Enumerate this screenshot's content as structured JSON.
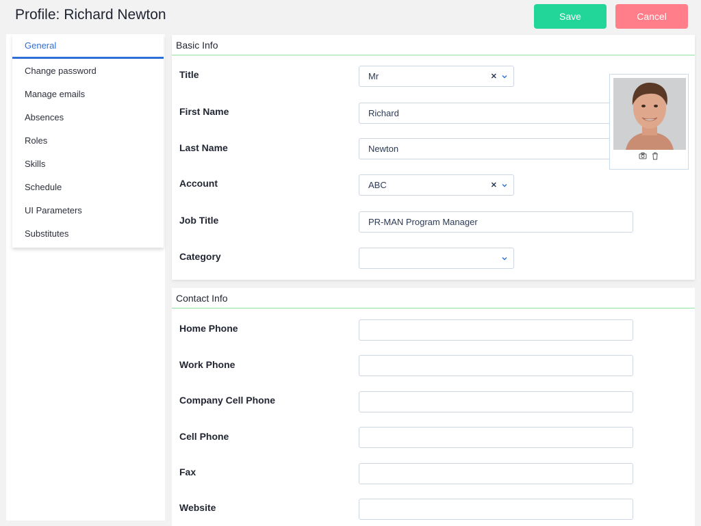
{
  "header": {
    "title": "Profile: Richard Newton",
    "save_label": "Save",
    "cancel_label": "Cancel",
    "save_color": "#22d69a",
    "cancel_color": "#ff7e8a"
  },
  "sidebar": {
    "items": [
      {
        "label": "General",
        "active": true
      },
      {
        "label": "Change password"
      },
      {
        "label": "Manage emails"
      },
      {
        "label": "Absences"
      },
      {
        "label": "Roles"
      },
      {
        "label": "Skills"
      },
      {
        "label": "Schedule"
      },
      {
        "label": "UI Parameters"
      },
      {
        "label": "Substitutes"
      }
    ]
  },
  "basic_info": {
    "heading": "Basic Info",
    "title_label": "Title",
    "title_value": "Mr",
    "first_name_label": "First Name",
    "first_name_value": "Richard",
    "last_name_label": "Last Name",
    "last_name_value": "Newton",
    "account_label": "Account",
    "account_value": "ABC",
    "job_title_label": "Job Title",
    "job_title_value": "PR-MAN Program Manager",
    "category_label": "Category",
    "category_value": ""
  },
  "contact_info": {
    "heading": "Contact Info",
    "home_phone_label": "Home Phone",
    "work_phone_label": "Work Phone",
    "company_cell_label": "Company Cell Phone",
    "cell_phone_label": "Cell Phone",
    "fax_label": "Fax",
    "website_label": "Website"
  },
  "icons": {
    "clear": "close-icon",
    "dropdown": "chevron-down-icon",
    "camera": "camera-icon",
    "delete": "trash-icon"
  },
  "accent_color": "#2d6fd6",
  "divider_color": "#8ee39f"
}
